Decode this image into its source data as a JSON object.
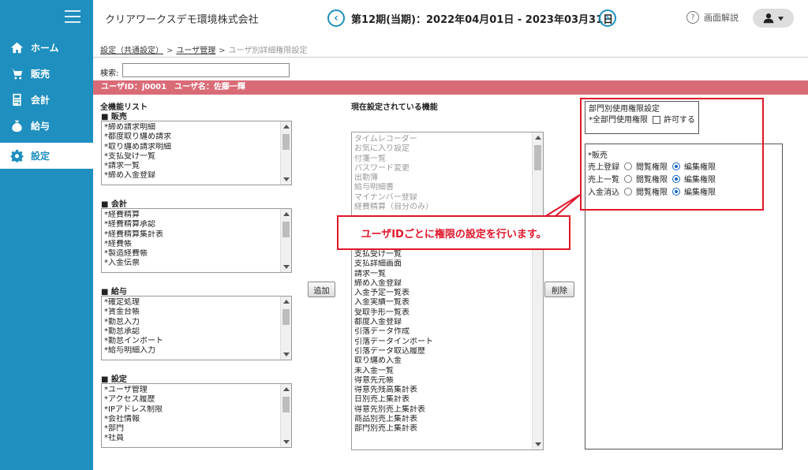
{
  "sidebar": {
    "items": [
      {
        "label": "ホーム",
        "icon": "home-icon"
      },
      {
        "label": "販売",
        "icon": "cart-icon"
      },
      {
        "label": "会計",
        "icon": "calculator-icon"
      },
      {
        "label": "給与",
        "icon": "money-bag-icon"
      },
      {
        "label": "設定",
        "icon": "gear-icon"
      }
    ],
    "active": "設定"
  },
  "header": {
    "company": "クリアワークスデモ環境株式会社",
    "period": "第12期(当期)：2022年04月01日 - 2023年03月31日",
    "prev": "‹",
    "next": "›",
    "help_label": "画面解説",
    "help_icon": "?"
  },
  "breadcrumb": {
    "level1": "設定（共通設定）",
    "level2": "ユーザ管理",
    "current": "ユーザ別詳細権限設定",
    "separator": ">"
  },
  "search": {
    "label": "検索:",
    "value": ""
  },
  "user_bar": "ユーザID：j0001　ユーザ名：佐藤一輝",
  "all_functions": {
    "title": "全機能リスト",
    "groups": [
      {
        "name": "■ 販売",
        "items": [
          "*締め請求明細",
          "*都度取り纏め請求",
          "*取り纏め請求明細",
          "*支払受け一覧",
          "*請求一覧",
          "*締め入金登録"
        ]
      },
      {
        "name": "■ 会計",
        "items": [
          "*経費精算",
          "*経費精算承認",
          "*経費精算集計表",
          "*経費帳",
          "*製造経費帳",
          "*入金伝票"
        ]
      },
      {
        "name": "■ 給与",
        "items": [
          "*確定処理",
          "*賃金台帳",
          "*勤怠入力",
          "*勤怠承認",
          "*勤怠インポート",
          "*給与明細入力"
        ]
      },
      {
        "name": "■ 設定",
        "items": [
          "*ユーザ管理",
          "*アクセス履歴",
          "*IPアドレス制限",
          "*会社情報",
          "*部門",
          "*社員"
        ]
      }
    ]
  },
  "current_functions": {
    "title": "現在設定されている機能",
    "gray_items": [
      "タイムレコーダー",
      "お気に入り設定",
      "付箋一覧",
      "パスワード変更",
      "出勤簿",
      "給与明細書",
      "マイナンバー登録",
      "経費精算（自分のみ）"
    ],
    "items": [
      "支払受け一覧",
      "支払詳細画面",
      "請求一覧",
      "締め入金登録",
      "入金予定一覧表",
      "入金実績一覧表",
      "受取手形一覧表",
      "都度入金登録",
      "引落データ作成",
      "引落データインポート",
      "引落データ取込履歴",
      "取り纏め入金",
      "未入金一覧",
      "得意先元帳",
      "得意先残高集計表",
      "日別売上集計表",
      "得意先別売上集計表",
      "商品別売上集計表",
      "部門別売上集計表"
    ]
  },
  "buttons": {
    "add": "追加",
    "remove": "削除"
  },
  "dept_permission": {
    "title": "部門別使用権限設定",
    "all_label": "*全部門使用権限",
    "allow_label": "許可する"
  },
  "permissions": {
    "group": "*販売",
    "view_label": "閲覧権限",
    "edit_label": "編集権限",
    "rows": [
      {
        "label": "売上登録",
        "selected": "edit"
      },
      {
        "label": "売上一覧",
        "selected": "edit"
      },
      {
        "label": "入金消込",
        "selected": "edit"
      }
    ]
  },
  "callout": "ユーザIDごとに権限の設定を行います。",
  "colors": {
    "sidebar": "#1e8fbf",
    "user_bar": "#d96b77",
    "highlight": "#e0162a"
  }
}
